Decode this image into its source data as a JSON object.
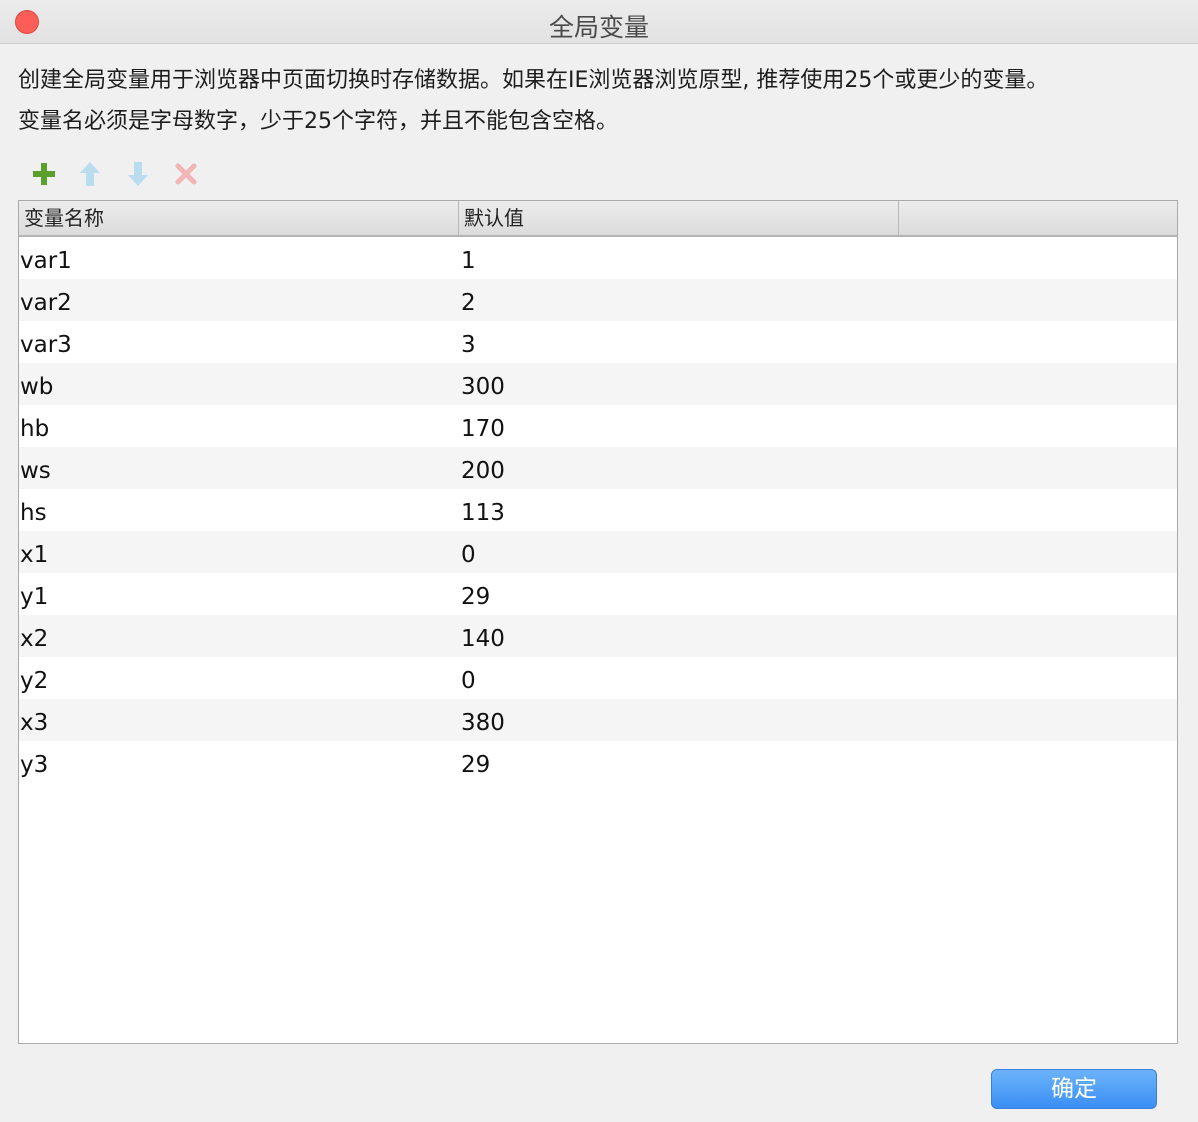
{
  "window": {
    "title": "全局变量"
  },
  "description": {
    "line1": "创建全局变量用于浏览器中页面切换时存储数据。如果在IE浏览器浏览原型, 推荐使用25个或更少的变量。",
    "line2": "变量名必须是字母数字，少于25个字符，并且不能包含空格。"
  },
  "toolbar": {
    "icons": [
      "add-icon",
      "move-up-icon",
      "move-down-icon",
      "delete-icon"
    ],
    "colors": {
      "add": "#5aa02c",
      "up": "#b9dcef",
      "down": "#b9dcef",
      "delete": "#f2b6b6"
    }
  },
  "table": {
    "columns": [
      "变量名称",
      "默认值",
      ""
    ],
    "rows": [
      {
        "name": "var1",
        "value": "1"
      },
      {
        "name": "var2",
        "value": "2"
      },
      {
        "name": "var3",
        "value": "3"
      },
      {
        "name": "wb",
        "value": "300"
      },
      {
        "name": "hb",
        "value": "170"
      },
      {
        "name": "ws",
        "value": "200"
      },
      {
        "name": "hs",
        "value": "113"
      },
      {
        "name": "x1",
        "value": "0"
      },
      {
        "name": "y1",
        "value": "29"
      },
      {
        "name": "x2",
        "value": "140"
      },
      {
        "name": "y2",
        "value": "0"
      },
      {
        "name": "x3",
        "value": "380"
      },
      {
        "name": "y3",
        "value": "29"
      }
    ]
  },
  "footer": {
    "ok_label": "确定"
  },
  "colors": {
    "close_button": "#fc5d57",
    "primary_button": "#3a8ef4"
  }
}
